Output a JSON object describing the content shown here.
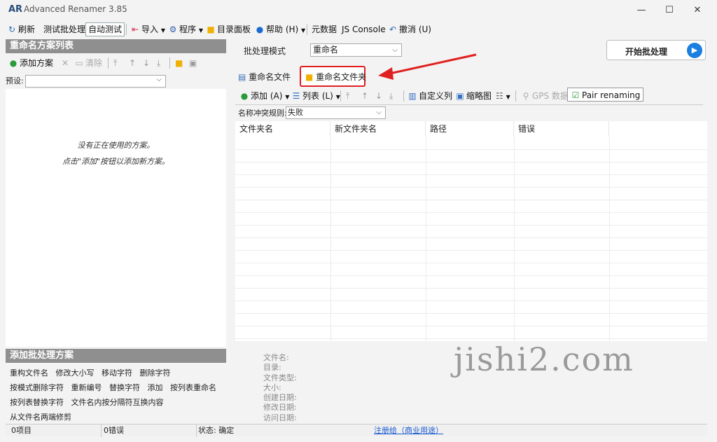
{
  "window": {
    "title": "Advanced Renamer 3.85",
    "logo": "AR",
    "min": "—",
    "max": "☐",
    "close": "✕"
  },
  "toolbar": {
    "refresh": "刷新",
    "test_batch": "测试批处理",
    "auto_test": "自动测试",
    "import": "导入",
    "program": "程序",
    "dir_panel": "目录面板",
    "help": "帮助 (H)",
    "metadata": "元数据",
    "js_console": "JS Console",
    "undo": "撤消 (U)"
  },
  "left": {
    "methods_title": "重命名方案列表",
    "add_method": "添加方案",
    "clear": "清除",
    "preset_label": "预设:",
    "empty_line1": "没有正在使用的方案。",
    "empty_line2": "点击\"添加\"按钮以添加新方案。",
    "add_batch_title": "添加批处理方案",
    "methods_rows": [
      [
        "重构文件名",
        "修改大小写",
        "移动字符",
        "删除字符"
      ],
      [
        "按模式删除字符",
        "重新编号",
        "替换字符",
        "添加",
        "按列表重命名"
      ],
      [
        "按列表替换字符",
        "文件名内按分隔符互换内容"
      ],
      [
        "从文件名两端修剪"
      ]
    ]
  },
  "right": {
    "batch_mode_label": "批处理模式",
    "batch_mode_value": "重命名",
    "start_button": "开始批处理",
    "tabs": [
      {
        "label": "重命名文件"
      },
      {
        "label": "重命名文件夹"
      }
    ],
    "subtoolbar": {
      "add": "添加 (A)",
      "list": "列表 (L)",
      "custom_columns": "自定义列",
      "thumbnails": "缩略图",
      "gps": "GPS 数据",
      "pair": "Pair renaming"
    },
    "conflict_label": "名称冲突规则:",
    "conflict_value": "失败",
    "columns": [
      "文件夹名",
      "新文件夹名",
      "路径",
      "错误"
    ],
    "info_labels": [
      "文件名:",
      "目录:",
      "文件类型:",
      "大小:",
      "创建日期:",
      "修改日期:",
      "访问日期:"
    ]
  },
  "status": {
    "items": "0项目",
    "errors": "0错误",
    "state": "状态: 确定",
    "register": "注册给（商业用途）"
  },
  "watermark": "jishi2.com",
  "colors": {
    "accent": "#1a7fe0",
    "highlight": "#e02020",
    "panel_head": "#8f8f8f"
  }
}
